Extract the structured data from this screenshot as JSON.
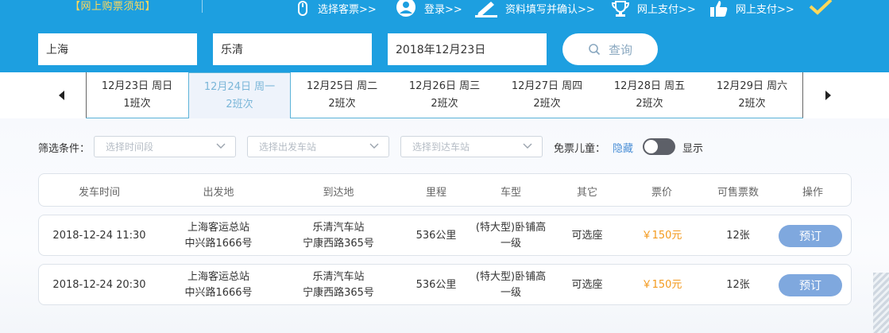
{
  "header": {
    "notice": "【网上购票须知】",
    "steps": [
      {
        "label": "选择客票>>",
        "icon": "mouse-icon"
      },
      {
        "label": "登录>>",
        "icon": "user-icon"
      },
      {
        "label": "资料填写并确认>>",
        "icon": "edit-icon"
      },
      {
        "label": "网上支付>>",
        "icon": "trophy-icon"
      },
      {
        "label": "网上支付>>",
        "icon": "thumbs-up-icon"
      },
      {
        "label": "",
        "icon": "check-icon"
      }
    ]
  },
  "search": {
    "from": "上海",
    "to": "乐清",
    "date": "2018年12月23日",
    "query_label": "查询"
  },
  "dates": [
    {
      "day": "12月23日 周日",
      "trips": "1班次"
    },
    {
      "day": "12月24日 周一",
      "trips": "2班次",
      "active": true
    },
    {
      "day": "12月25日 周二",
      "trips": "2班次"
    },
    {
      "day": "12月26日 周三",
      "trips": "2班次"
    },
    {
      "day": "12月27日 周四",
      "trips": "2班次"
    },
    {
      "day": "12月28日 周五",
      "trips": "2班次"
    },
    {
      "day": "12月29日 周六",
      "trips": "2班次"
    }
  ],
  "filter": {
    "label": "筛选条件：",
    "time_placeholder": "选择时间段",
    "depart_placeholder": "选择出发车站",
    "arrive_placeholder": "选择到达车站",
    "child_label": "免票儿童：",
    "hide_label": "隐藏",
    "show_label": "显示"
  },
  "table": {
    "headers": [
      "发车时间",
      "出发地",
      "到达地",
      "里程",
      "车型",
      "其它",
      "票价",
      "可售票数",
      "操作"
    ],
    "rows": [
      {
        "time": "2018-12-24 11:30",
        "from_station": "上海客运总站",
        "from_addr": "中兴路1666号",
        "to_station": "乐清汽车站",
        "to_addr": "宁康西路365号",
        "distance": "536公里",
        "type_line1": "(特大型)卧铺高",
        "type_line2": "一级",
        "other": "可选座",
        "price": "￥150元",
        "tickets": "12张",
        "action": "预订"
      },
      {
        "time": "2018-12-24 20:30",
        "from_station": "上海客运总站",
        "from_addr": "中兴路1666号",
        "to_station": "乐清汽车站",
        "to_addr": "宁康西路365号",
        "distance": "536公里",
        "type_line1": "(特大型)卧铺高",
        "type_line2": "一级",
        "other": "可选座",
        "price": "￥150元",
        "tickets": "12张",
        "action": "预订"
      }
    ]
  },
  "colors": {
    "header_bg": "#1d9fe0",
    "notice": "#ffd85a",
    "price": "#f39a1e",
    "book_button": "#7fa8de",
    "active_date": "#7ab6d8"
  }
}
